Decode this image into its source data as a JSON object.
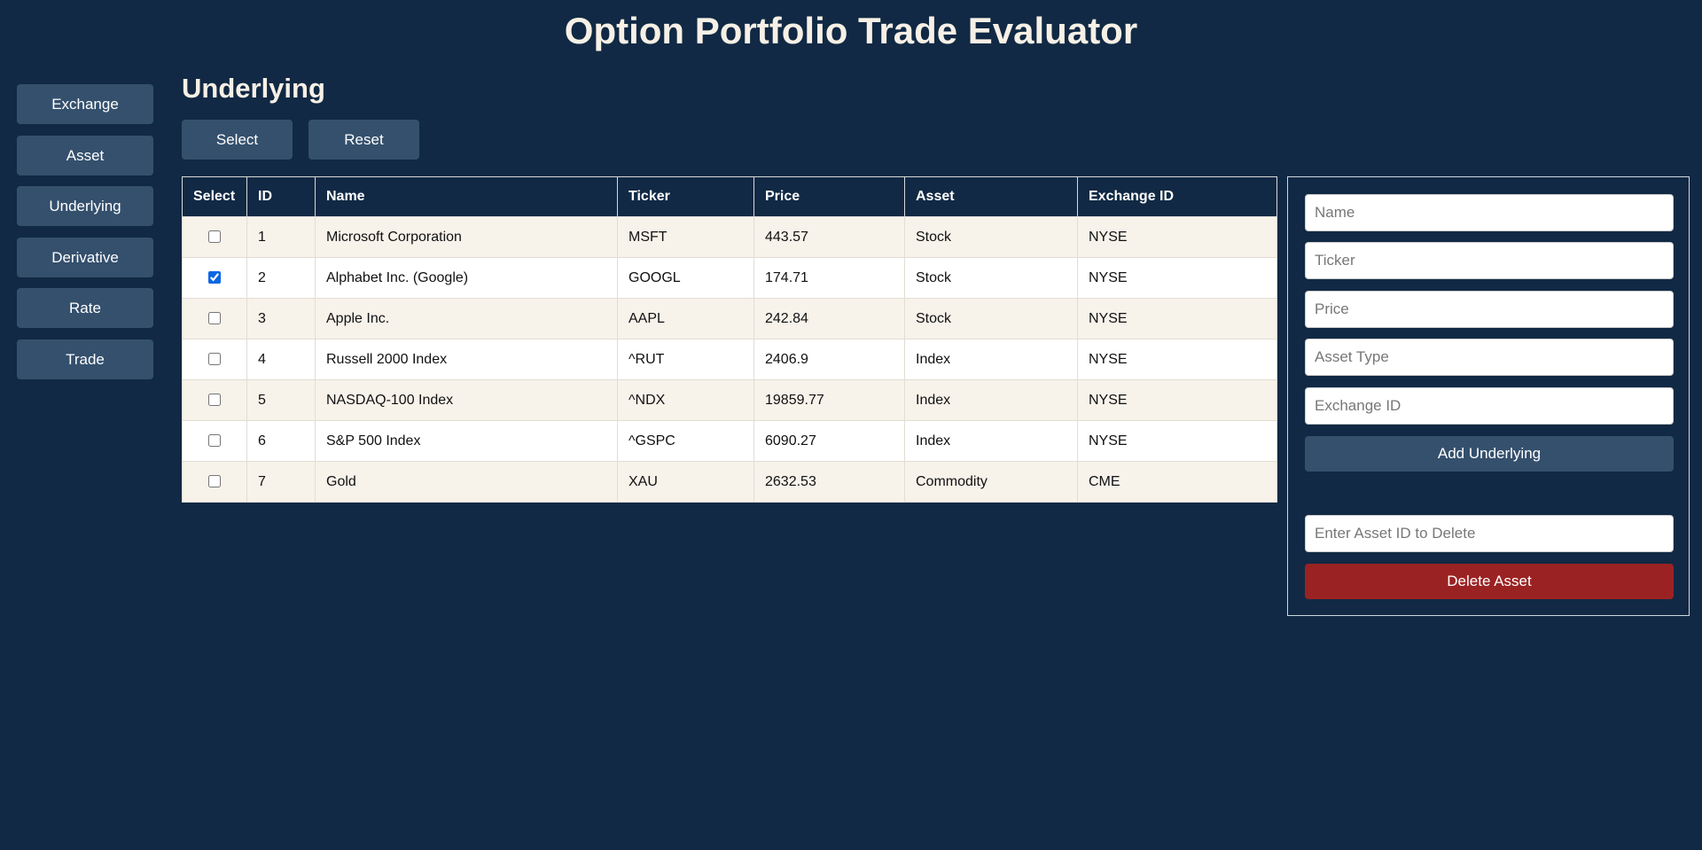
{
  "app": {
    "title": "Option Portfolio Trade Evaluator"
  },
  "sidebar": {
    "items": [
      {
        "label": "Exchange"
      },
      {
        "label": "Asset"
      },
      {
        "label": "Underlying"
      },
      {
        "label": "Derivative"
      },
      {
        "label": "Rate"
      },
      {
        "label": "Trade"
      }
    ]
  },
  "main": {
    "section_title": "Underlying",
    "select_label": "Select",
    "reset_label": "Reset"
  },
  "table": {
    "headers": [
      "Select",
      "ID",
      "Name",
      "Ticker",
      "Price",
      "Asset",
      "Exchange ID"
    ],
    "rows": [
      {
        "checked": false,
        "id": "1",
        "name": "Microsoft Corporation",
        "ticker": "MSFT",
        "price": "443.57",
        "asset": "Stock",
        "exchange": "NYSE"
      },
      {
        "checked": true,
        "id": "2",
        "name": "Alphabet Inc. (Google)",
        "ticker": "GOOGL",
        "price": "174.71",
        "asset": "Stock",
        "exchange": "NYSE"
      },
      {
        "checked": false,
        "id": "3",
        "name": "Apple Inc.",
        "ticker": "AAPL",
        "price": "242.84",
        "asset": "Stock",
        "exchange": "NYSE"
      },
      {
        "checked": false,
        "id": "4",
        "name": "Russell 2000 Index",
        "ticker": "^RUT",
        "price": "2406.9",
        "asset": "Index",
        "exchange": "NYSE"
      },
      {
        "checked": false,
        "id": "5",
        "name": "NASDAQ-100 Index",
        "ticker": "^NDX",
        "price": "19859.77",
        "asset": "Index",
        "exchange": "NYSE"
      },
      {
        "checked": false,
        "id": "6",
        "name": "S&P 500 Index",
        "ticker": "^GSPC",
        "price": "6090.27",
        "asset": "Index",
        "exchange": "NYSE"
      },
      {
        "checked": false,
        "id": "7",
        "name": "Gold",
        "ticker": "XAU",
        "price": "2632.53",
        "asset": "Commodity",
        "exchange": "CME"
      }
    ]
  },
  "form": {
    "name_placeholder": "Name",
    "ticker_placeholder": "Ticker",
    "price_placeholder": "Price",
    "asset_type_placeholder": "Asset Type",
    "exchange_id_placeholder": "Exchange ID",
    "add_label": "Add Underlying",
    "delete_placeholder": "Enter Asset ID to Delete",
    "delete_label": "Delete Asset"
  },
  "colors": {
    "background": "#112944",
    "button": "#34506d",
    "delete_button": "#9b2222",
    "row_odd": "#f7f2ea",
    "row_even": "#ffffff"
  }
}
